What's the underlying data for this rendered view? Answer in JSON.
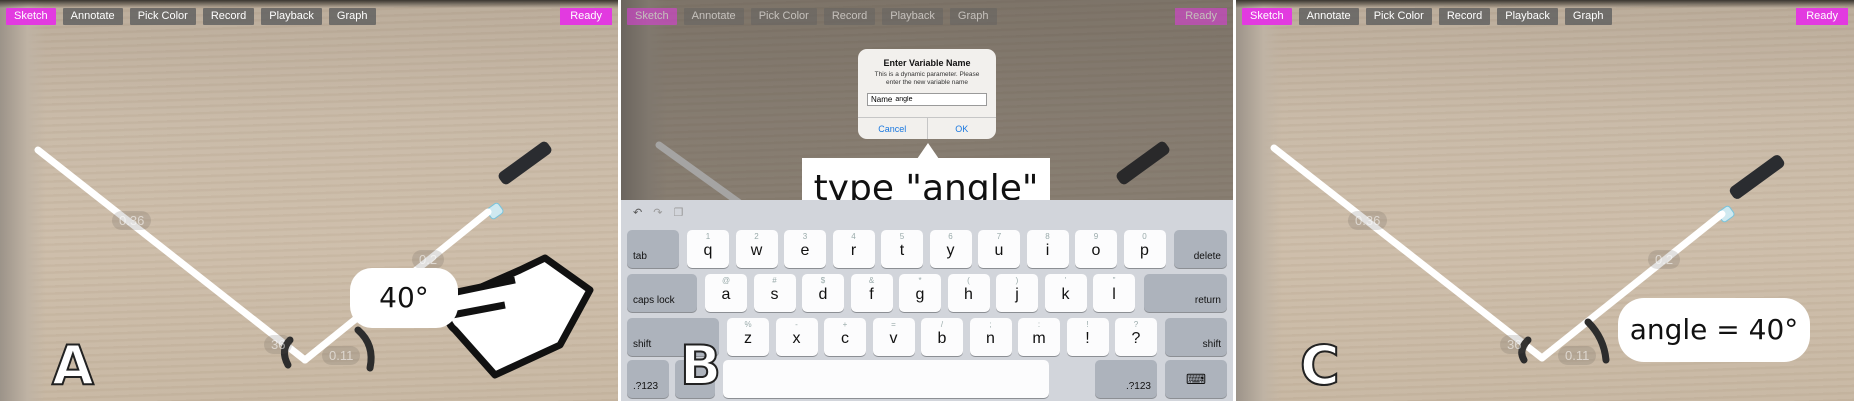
{
  "toolbar": {
    "buttons": [
      "Sketch",
      "Annotate",
      "Pick Color",
      "Record",
      "Playback",
      "Graph"
    ],
    "status": "Ready",
    "active_color": "#e23ae0"
  },
  "panels": {
    "a": {
      "letter": "A",
      "measure_left": "0.36",
      "measure_right": "0.2",
      "measure_base_left": "36",
      "measure_base_right": "0.11",
      "angle_bubble": "40°",
      "hand_icon": "pointing-hand-icon"
    },
    "b": {
      "letter": "B",
      "dialog": {
        "title": "Enter Variable Name",
        "message": "This is a dynamic parameter. Please enter the new variable name",
        "field_label": "Name",
        "field_value": "angle",
        "cancel": "Cancel",
        "ok": "OK"
      },
      "callout": "type \"angle\"",
      "keyboard": {
        "row1": [
          [
            "1",
            "q"
          ],
          [
            "2",
            "w"
          ],
          [
            "3",
            "e"
          ],
          [
            "4",
            "r"
          ],
          [
            "5",
            "t"
          ],
          [
            "6",
            "y"
          ],
          [
            "7",
            "u"
          ],
          [
            "8",
            "i"
          ],
          [
            "9",
            "o"
          ],
          [
            "0",
            "p"
          ]
        ],
        "row2": [
          [
            "@",
            "a"
          ],
          [
            "#",
            "s"
          ],
          [
            "$",
            "d"
          ],
          [
            "&",
            "f"
          ],
          [
            "*",
            "g"
          ],
          [
            "(",
            "h"
          ],
          [
            ")",
            "j"
          ],
          [
            "'",
            "k"
          ],
          [
            "\"",
            "l"
          ]
        ],
        "row3": [
          [
            "%",
            "z"
          ],
          [
            "-",
            "x"
          ],
          [
            "+",
            "c"
          ],
          [
            "=",
            "v"
          ],
          [
            "/",
            "b"
          ],
          [
            ";",
            "n"
          ],
          [
            ":",
            "m"
          ],
          [
            "!",
            "!"
          ],
          [
            "?",
            "?"
          ]
        ],
        "tab": "tab",
        "delete": "delete",
        "caps": "caps lock",
        "return": "return",
        "shift": "shift",
        "numbers": ".?123"
      }
    },
    "c": {
      "letter": "C",
      "measure_left": "0.36",
      "measure_right": "0.2",
      "measure_base_left": "36",
      "measure_base_right": "0.11",
      "angle_bubble": "angle = 40°"
    }
  }
}
